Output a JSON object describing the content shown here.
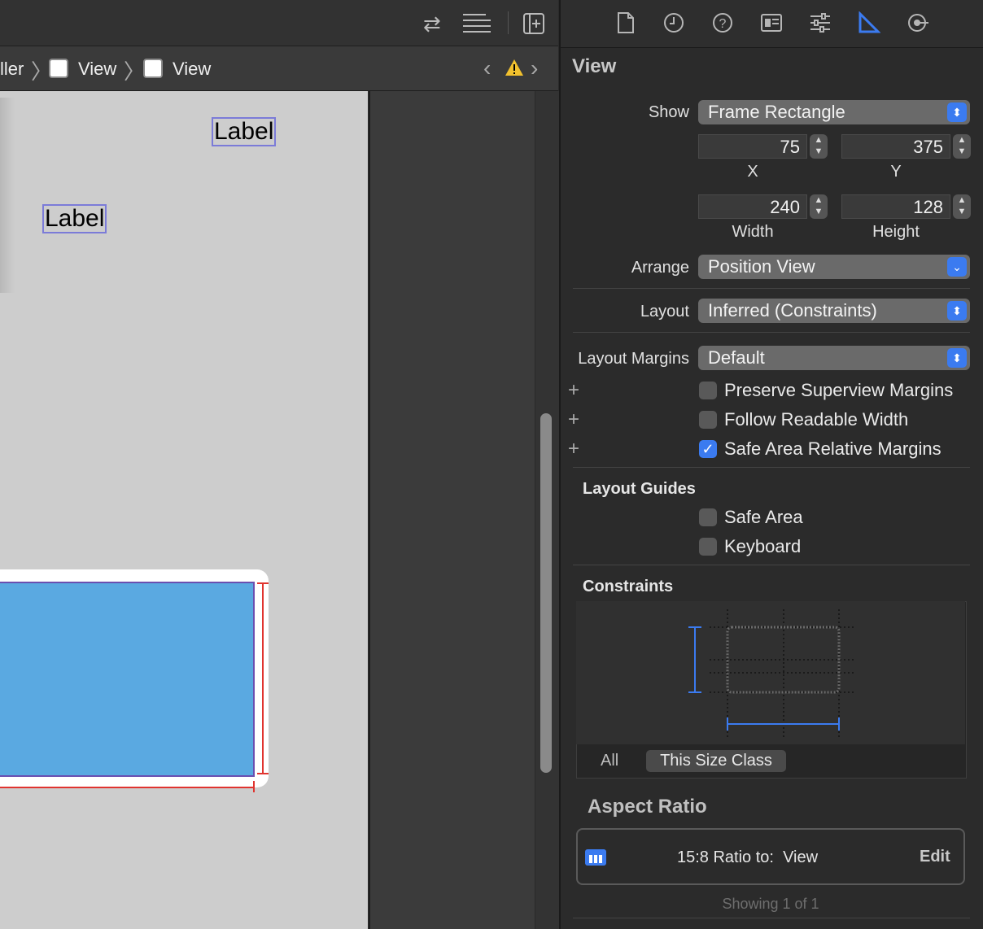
{
  "breadcrumb": {
    "prefix": "ller",
    "items": [
      "View",
      "View"
    ]
  },
  "canvas": {
    "labels": [
      "Label",
      "Label"
    ]
  },
  "inspector": {
    "title": "View",
    "show": {
      "label": "Show",
      "value": "Frame Rectangle"
    },
    "frame": {
      "x": "75",
      "y": "375",
      "width": "240",
      "height": "128",
      "x_caption": "X",
      "y_caption": "Y",
      "width_caption": "Width",
      "height_caption": "Height"
    },
    "arrange": {
      "label": "Arrange",
      "value": "Position View"
    },
    "layout": {
      "label": "Layout",
      "value": "Inferred (Constraints)"
    },
    "margins": {
      "label": "Layout Margins",
      "value": "Default"
    },
    "checkboxes": [
      {
        "label": "Preserve Superview Margins",
        "checked": false
      },
      {
        "label": "Follow Readable Width",
        "checked": false
      },
      {
        "label": "Safe Area Relative Margins",
        "checked": true
      }
    ],
    "guides": {
      "title": "Layout Guides",
      "items": [
        "Safe Area",
        "Keyboard"
      ]
    },
    "constraints": {
      "title": "Constraints",
      "seg_all": "All",
      "seg_size": "This Size Class"
    },
    "aspect": {
      "title": "Aspect Ratio",
      "text": "15:8 Ratio to:  View",
      "edit": "Edit",
      "footer": "Showing 1 of 1"
    }
  },
  "colors": {
    "accent": "#3b7bf0",
    "blue_view": "#5aa9e1",
    "canvas": "#cdcdcd",
    "warning": "#f2c12e"
  }
}
